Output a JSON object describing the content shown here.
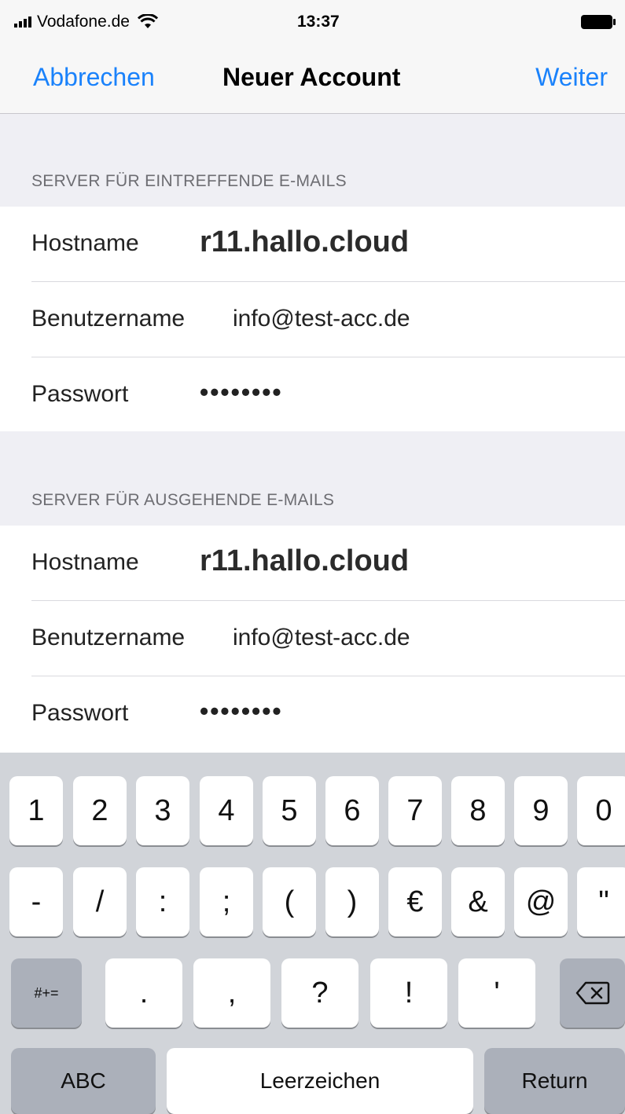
{
  "status_bar": {
    "carrier": "Vodafone.de",
    "time": "13:37"
  },
  "nav": {
    "cancel": "Abbrechen",
    "title": "Neuer Account",
    "next": "Weiter"
  },
  "incoming": {
    "header": "SERVER FÜR EINTREFFENDE E-MAILS",
    "hostname_label": "Hostname",
    "hostname_value": "r11.hallo.cloud",
    "username_label": "Benutzername",
    "username_value": "info@test-acc.de",
    "password_label": "Passwort",
    "password_value": "••••••••"
  },
  "outgoing": {
    "header": "SERVER FÜR AUSGEHENDE E-MAILS",
    "hostname_label": "Hostname",
    "hostname_value": "r11.hallo.cloud",
    "username_label": "Benutzername",
    "username_value": "info@test-acc.de",
    "password_label": "Passwort",
    "password_value": "••••••••"
  },
  "keyboard": {
    "row1": [
      "1",
      "2",
      "3",
      "4",
      "5",
      "6",
      "7",
      "8",
      "9",
      "0"
    ],
    "row2": [
      "-",
      "/",
      ":",
      ";",
      "(",
      ")",
      "€",
      "&",
      "@",
      "\""
    ],
    "row3": [
      ".",
      ",",
      "?",
      "!",
      "'"
    ],
    "symbols": "#+=",
    "abc": "ABC",
    "space": "Leerzeichen",
    "return": "Return"
  }
}
